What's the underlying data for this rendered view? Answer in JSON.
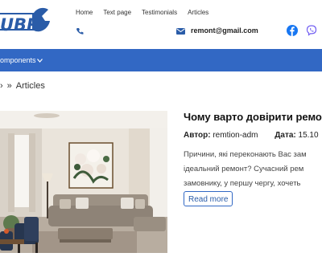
{
  "header": {
    "logo_text": "UBR",
    "nav": [
      "Home",
      "Text page",
      "Testimonials",
      "Articles"
    ],
    "email": "remont@gmail.com"
  },
  "menubar": {
    "item_label": "omponents"
  },
  "breadcrumb": {
    "current": "Articles"
  },
  "article": {
    "title": "Чому варто довірити ремо",
    "author_label": "Автор:",
    "author": "remtion-adm",
    "date_label": "Дата:",
    "date": "15.10",
    "excerpt_lines": [
      "Причини, які переконають Вас зам",
      "ідеальний ремонт? Сучасний рем",
      "замовнику, у першу чергу, хочеть"
    ],
    "read_more": "Read more"
  },
  "colors": {
    "brand_blue": "#3268c4",
    "logo_blue": "#2a5ca8"
  }
}
